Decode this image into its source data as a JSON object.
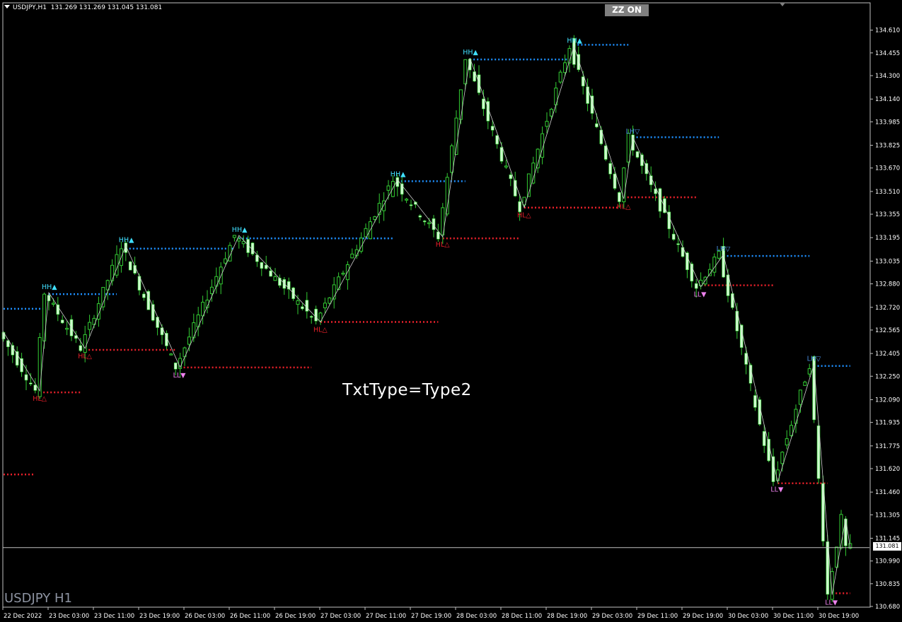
{
  "header": {
    "symbol_tf": "USDJPY,H1",
    "ohlc": "131.269 131.269 131.045 131.081"
  },
  "zz_button": "ZZ ON",
  "symbol_label": "USDJPY H1",
  "annotation": "TxtType=Type2",
  "current_price": "131.081",
  "colors": {
    "background": "#000000",
    "candle_bull": "#ccffcc",
    "candle_wick": "#33cc33",
    "zigzag": "#cfcfcf",
    "high_level": "#1e90ff",
    "low_level": "#e8202a",
    "hh_label": "#40e0ff",
    "lh_label": "#4a90e2",
    "hl_label": "#e8202a",
    "ll_label": "#ee82ee"
  },
  "chart_data": {
    "type": "candlestick",
    "ylim": [
      130.68,
      134.7
    ],
    "yticks": [
      "134.610",
      "134.455",
      "134.300",
      "134.140",
      "133.985",
      "133.825",
      "133.670",
      "133.510",
      "133.355",
      "133.195",
      "133.035",
      "132.880",
      "132.720",
      "132.565",
      "132.405",
      "132.250",
      "132.090",
      "131.935",
      "131.775",
      "131.620",
      "131.460",
      "131.305",
      "131.145",
      "130.990",
      "130.835",
      "130.680"
    ],
    "xticks": [
      "22 Dec 2022",
      "23 Dec 03:00",
      "23 Dec 11:00",
      "23 Dec 19:00",
      "26 Dec 03:00",
      "26 Dec 11:00",
      "26 Dec 19:00",
      "27 Dec 03:00",
      "27 Dec 11:00",
      "27 Dec 19:00",
      "28 Dec 03:00",
      "28 Dec 11:00",
      "28 Dec 19:00",
      "29 Dec 03:00",
      "29 Dec 11:00",
      "29 Dec 19:00",
      "30 Dec 03:00",
      "30 Dec 11:00",
      "30 Dec 19:00"
    ],
    "current_price": 131.081,
    "zigzag": [
      {
        "bar": 0,
        "price": 132.55
      },
      {
        "bar": 8,
        "price": 132.15,
        "label": "HL△",
        "kind": "HL"
      },
      {
        "bar": 10,
        "price": 132.82,
        "label": "HH▲",
        "kind": "HH"
      },
      {
        "bar": 18,
        "price": 132.44,
        "label": "HL△",
        "kind": "HL"
      },
      {
        "bar": 27,
        "price": 133.14,
        "label": "HH▲",
        "kind": "HH"
      },
      {
        "bar": 39,
        "price": 132.31,
        "label": "LL▼",
        "kind": "LL"
      },
      {
        "bar": 52,
        "price": 133.21,
        "label": "HH▲",
        "kind": "HH"
      },
      {
        "bar": 70,
        "price": 132.62,
        "label": "HL△",
        "kind": "HL"
      },
      {
        "bar": 87,
        "price": 133.59,
        "label": "HH▲",
        "kind": "HH"
      },
      {
        "bar": 97,
        "price": 133.2,
        "label": "HL△",
        "kind": "HL"
      },
      {
        "bar": 103,
        "price": 134.42,
        "label": "HH▲",
        "kind": "HH"
      },
      {
        "bar": 115,
        "price": 133.4,
        "label": "HL△",
        "kind": "HL"
      },
      {
        "bar": 126,
        "price": 134.5,
        "label": "HH▲",
        "kind": "HH"
      },
      {
        "bar": 137,
        "price": 133.46,
        "label": "HL△",
        "kind": "HL"
      },
      {
        "bar": 139,
        "price": 133.88,
        "label": "LH▽",
        "kind": "LH"
      },
      {
        "bar": 154,
        "price": 132.86,
        "label": "LL▼",
        "kind": "LL"
      },
      {
        "bar": 159,
        "price": 133.08,
        "label": "LH▽",
        "kind": "LH"
      },
      {
        "bar": 171,
        "price": 131.53,
        "label": "LL▼",
        "kind": "LL"
      },
      {
        "bar": 179,
        "price": 132.33,
        "label": "LH▽",
        "kind": "LH"
      },
      {
        "bar": 183,
        "price": 130.76,
        "label": "LL▼",
        "kind": "LL"
      },
      {
        "bar": 186,
        "price": 131.28
      },
      {
        "bar": 187,
        "price": 131.08
      }
    ],
    "levels": [
      {
        "price": 132.71,
        "from_bar": 0,
        "to_bar": 9,
        "kind": "high"
      },
      {
        "price": 132.14,
        "from_bar": 8,
        "to_bar": 17,
        "kind": "low"
      },
      {
        "price": 131.58,
        "from_bar": 0,
        "to_bar": 7,
        "kind": "low"
      },
      {
        "price": 132.81,
        "from_bar": 10,
        "to_bar": 25,
        "kind": "high"
      },
      {
        "price": 132.43,
        "from_bar": 18,
        "to_bar": 38,
        "kind": "low"
      },
      {
        "price": 133.12,
        "from_bar": 27,
        "to_bar": 51,
        "kind": "high"
      },
      {
        "price": 132.31,
        "from_bar": 39,
        "to_bar": 68,
        "kind": "low"
      },
      {
        "price": 133.19,
        "from_bar": 52,
        "to_bar": 86,
        "kind": "high"
      },
      {
        "price": 132.62,
        "from_bar": 70,
        "to_bar": 96,
        "kind": "low"
      },
      {
        "price": 133.58,
        "from_bar": 87,
        "to_bar": 102,
        "kind": "high"
      },
      {
        "price": 133.19,
        "from_bar": 97,
        "to_bar": 114,
        "kind": "low"
      },
      {
        "price": 134.41,
        "from_bar": 103,
        "to_bar": 125,
        "kind": "high"
      },
      {
        "price": 133.4,
        "from_bar": 115,
        "to_bar": 136,
        "kind": "low"
      },
      {
        "price": 134.51,
        "from_bar": 126,
        "to_bar": 138,
        "kind": "high"
      },
      {
        "price": 133.47,
        "from_bar": 137,
        "to_bar": 153,
        "kind": "low"
      },
      {
        "price": 133.88,
        "from_bar": 139,
        "to_bar": 158,
        "kind": "high"
      },
      {
        "price": 132.87,
        "from_bar": 154,
        "to_bar": 170,
        "kind": "low"
      },
      {
        "price": 133.07,
        "from_bar": 159,
        "to_bar": 178,
        "kind": "high"
      },
      {
        "price": 131.52,
        "from_bar": 171,
        "to_bar": 182,
        "kind": "low"
      },
      {
        "price": 132.32,
        "from_bar": 179,
        "to_bar": 187,
        "kind": "high"
      },
      {
        "price": 130.77,
        "from_bar": 183,
        "to_bar": 187,
        "kind": "low"
      }
    ]
  }
}
